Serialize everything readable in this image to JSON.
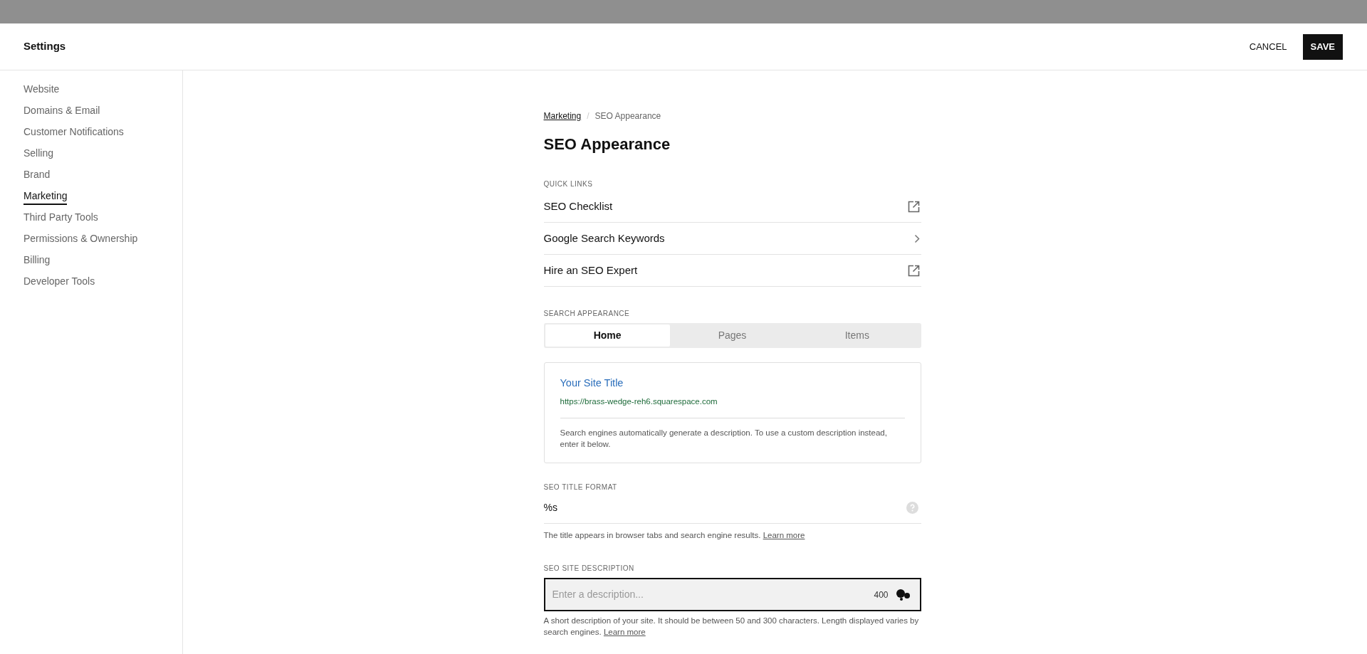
{
  "header": {
    "title": "Settings",
    "cancel": "CANCEL",
    "save": "SAVE"
  },
  "sidebar": {
    "items": [
      {
        "label": "Website",
        "selected": false
      },
      {
        "label": "Domains & Email",
        "selected": false
      },
      {
        "label": "Customer Notifications",
        "selected": false
      },
      {
        "label": "Selling",
        "selected": false
      },
      {
        "label": "Brand",
        "selected": false
      },
      {
        "label": "Marketing",
        "selected": true
      },
      {
        "label": "Third Party Tools",
        "selected": false
      },
      {
        "label": "Permissions & Ownership",
        "selected": false
      },
      {
        "label": "Billing",
        "selected": false
      },
      {
        "label": "Developer Tools",
        "selected": false
      }
    ]
  },
  "breadcrumb": {
    "parent": "Marketing",
    "separator": "/",
    "current": "SEO Appearance"
  },
  "page_title": "SEO Appearance",
  "quick_links": {
    "label": "QUICK LINKS",
    "items": [
      {
        "label": "SEO Checklist",
        "kind": "external"
      },
      {
        "label": "Google Search Keywords",
        "kind": "chevron"
      },
      {
        "label": "Hire an SEO Expert",
        "kind": "external"
      }
    ]
  },
  "search_appearance": {
    "label": "SEARCH APPEARANCE",
    "tabs": [
      {
        "label": "Home",
        "selected": true
      },
      {
        "label": "Pages",
        "selected": false
      },
      {
        "label": "Items",
        "selected": false
      }
    ],
    "preview": {
      "title": "Your Site Title",
      "url": "https://brass-wedge-reh6.squarespace.com",
      "description": "Search engines automatically generate a description. To use a custom description instead, enter it below."
    }
  },
  "seo_title_format": {
    "label": "SEO TITLE FORMAT",
    "value": "%s",
    "help": "The title appears in browser tabs and search engine results.",
    "link": "Learn more"
  },
  "seo_site_description": {
    "label": "SEO SITE DESCRIPTION",
    "placeholder": "Enter a description...",
    "counter": "400",
    "help": "A short description of your site. It should be between 50 and 300 characters. Length displayed varies by search engines.",
    "link": "Learn more"
  }
}
